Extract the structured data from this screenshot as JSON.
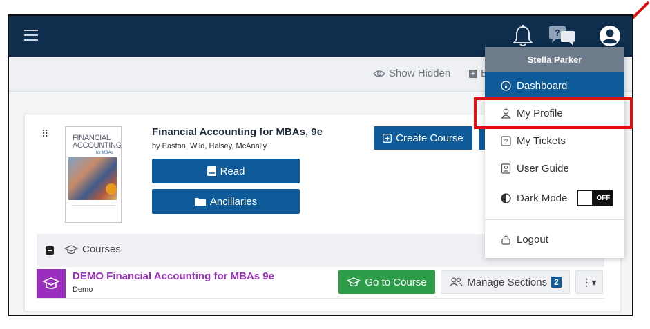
{
  "toolbar": {
    "show_hidden_label": "Show Hidden",
    "edit_label_partial": "E"
  },
  "book": {
    "title": "Financial Accounting for MBAs, 9e",
    "authors": "by Easton, Wild, Halsey, McAnally",
    "cover_text": "FINANCIAL ACCOUNTING",
    "cover_subtext": "for MBAs",
    "read_label": "Read",
    "ancillaries_label": "Ancillaries",
    "create_course_label": "Create Course"
  },
  "courses": {
    "header_label": "Courses",
    "items": [
      {
        "title": "DEMO Financial Accounting for MBAs 9e",
        "subtitle": "Demo",
        "go_label": "Go to Course",
        "manage_label": "Manage Sections",
        "section_count": "2"
      }
    ]
  },
  "user_menu": {
    "user_name": "Stella Parker",
    "items": [
      {
        "label": "Dashboard",
        "active": true
      },
      {
        "label": "My Profile",
        "highlighted": true
      },
      {
        "label": "My Tickets"
      },
      {
        "label": "User Guide"
      },
      {
        "label": "Dark Mode",
        "toggle": "OFF"
      },
      {
        "label": "Logout"
      }
    ]
  },
  "colors": {
    "navbar": "#0f2d4d",
    "primary": "#0f5a98",
    "success": "#2e9d4a",
    "course_accent": "#9b2fbd",
    "annotation_red": "#e01010"
  }
}
